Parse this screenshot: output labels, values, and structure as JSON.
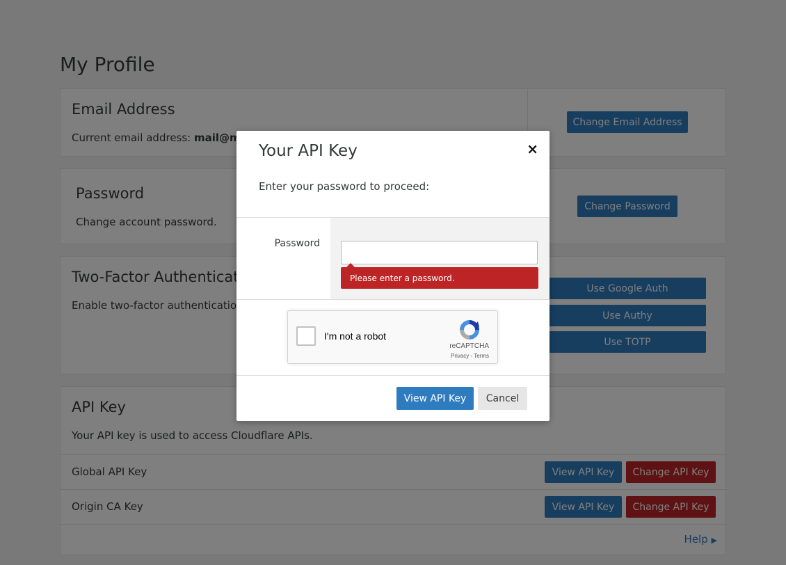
{
  "page_title": "My Profile",
  "email": {
    "heading": "Email Address",
    "current_prefix": "Current email address: ",
    "current_value": "mail@mai",
    "change_button": "Change Email Address"
  },
  "password": {
    "heading": "Password",
    "description": "Change account password.",
    "change_button": "Change Password"
  },
  "two_factor": {
    "heading": "Two-Factor Authenticat",
    "description": "Enable two-factor authentication v",
    "buttons": [
      "Use Google Auth",
      "Use Authy",
      "Use TOTP"
    ]
  },
  "api_key": {
    "heading": "API Key",
    "description": "Your API key is used to access Cloudflare APIs.",
    "rows": [
      {
        "label": "Global API Key",
        "view": "View API Key",
        "change": "Change API Key"
      },
      {
        "label": "Origin CA Key",
        "view": "View API Key",
        "change": "Change API Key"
      }
    ],
    "help": "Help"
  },
  "modal": {
    "title": "Your API Key",
    "close": "×",
    "description": "Enter your password to proceed:",
    "password_label": "Password",
    "password_value": "",
    "error": "Please enter a password.",
    "captcha_label": "I'm not a robot",
    "captcha_brand": "reCAPTCHA",
    "captcha_links": "Privacy - Terms",
    "primary_button": "View API Key",
    "cancel_button": "Cancel"
  },
  "colors": {
    "primary": "#2f7bbf",
    "danger": "#bd2426",
    "background": "#f2f2f2"
  }
}
